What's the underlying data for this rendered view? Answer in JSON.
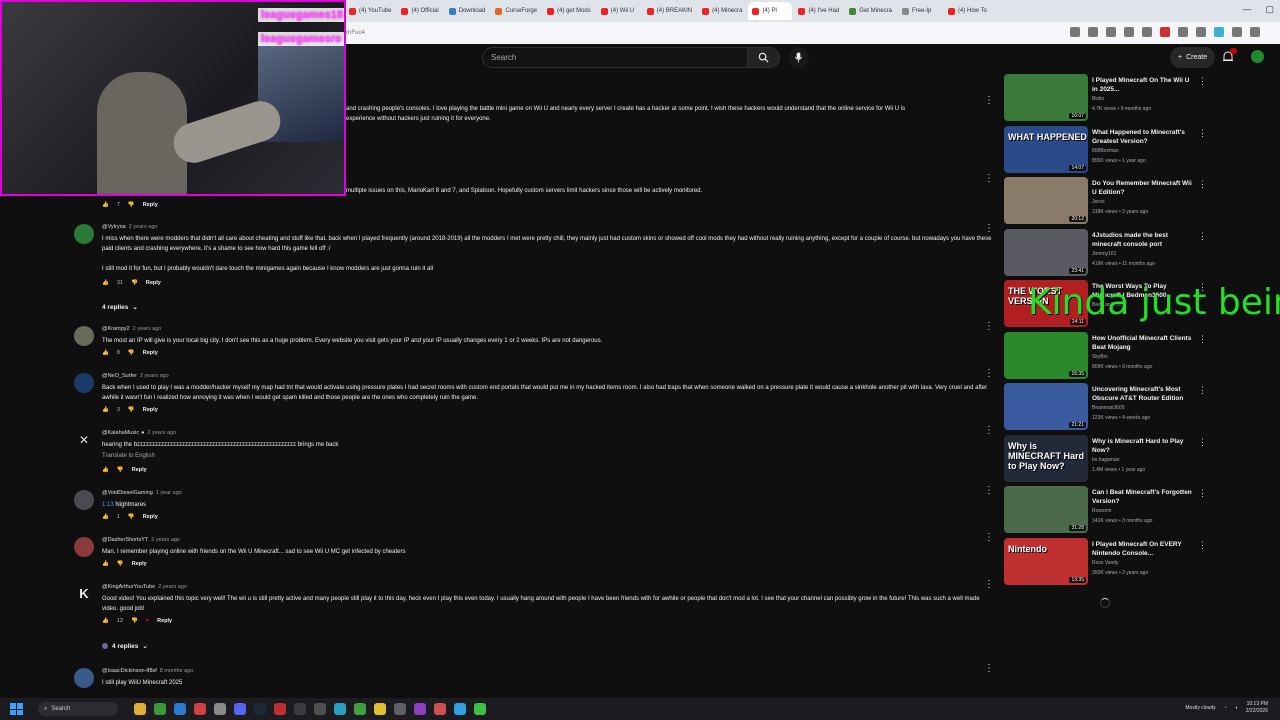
{
  "browser": {
    "tabs": [
      "(4) YouTube",
      "(4) Official",
      "Download",
      "CurseForge",
      "(4) get Mods",
      "(4) Wii U",
      "(4) BREAKIN",
      "(4) Minecra",
      "(4) Pl",
      "(4) I've Had",
      "Get Minecra",
      "Free-Ip",
      "(4) How To"
    ],
    "url": "xnFuo4"
  },
  "yt": {
    "search_placeholder": "Search",
    "create_label": "Create"
  },
  "webcam": {
    "ticker_line1": "leaguegames18",
    "ticker_line2": "leaguegamesre"
  },
  "comments": [
    {
      "text": "and crashing people's consoles. I love playing the battle mini game on Wii U and nearly every server I create has a hacker at some point. I wish these hackers would understand that the online service for Wii U is",
      "text2": "experience without hackers just ruining it for everyone."
    },
    {
      "text": "multiple issues on this, MarioKart 8 and 7, and Splatoon. Hopefully custom servers limit hackers since those will be actively monitored.",
      "likes": "7",
      "reply": "Reply"
    },
    {
      "author": "@Vylryna",
      "ago": "2 years ago",
      "text": "I miss when there were modders that didn't all care about cheating and stuff like that. back when I played frequently (around 2018-2019) all the modders I met were pretty chill, they mainly just had custom skins or showed off cool mods they had without really ruining anything, except for a couple of course. but nowadays you have these paid clients and crashing everywhere, it's a shame to see how hard this game fell off :/",
      "text2": "I still mod it for fun, but I probably wouldn't dare touch the minigames again because I know modders are just gonna ruin it all",
      "likes": "31",
      "reply": "Reply",
      "replies": "4 replies"
    },
    {
      "author": "@Krampy2",
      "ago": "2 years ago",
      "text": "The most an IP will give is your local big city. I don't see this as a huge problem. Every website you visit gets your IP and your IP usually changes every 1 or 2 weeks. IPs are not dangerous.",
      "likes": "8",
      "reply": "Reply"
    },
    {
      "author": "@NeO_Surfer",
      "ago": "2 years ago",
      "text": "Back when I used to play I was a modder/hacker myself my map had tnt that would activate using pressure plates I had secret rooms with custom end portals that would put me in my hacked items room. I also had traps that when someone walked on a pressure plate it would cause a sinkhole another pit with lava. Very cruel and after awhile it wasn't fun I realized how annoying it was when I would get spam killed and those people are the ones who completely ruin the game.",
      "likes": "3",
      "reply": "Reply"
    },
    {
      "author": "@KalahaMusic",
      "ago": "2 years ago",
      "text": "hearing the bzzzzzzzzzzzzzzzzzzzzzzzzzzzzzzzzzzzzzzzzzzzzzzzzzzzzz brings me back",
      "translate": "Translate to English",
      "reply": "Reply"
    },
    {
      "author": "@VoidDieselGaming",
      "ago": "1 year ago",
      "timestamp": "1:13",
      "text": " Nightmares",
      "likes": "1",
      "reply": "Reply"
    },
    {
      "author": "@DasherShortsYT",
      "ago": "2 years ago",
      "text": "Man, I remember playing online with friends on the Wii U Minecraft... sad to see Wii U MC get infected by cheaters",
      "reply": "Reply"
    },
    {
      "author": "@KingArthurYouTube",
      "ago": "2 years ago",
      "text": "Good video! You explained this topic very well! The wii u is still pretty active and many people still play it to this day, heck even I play this even today. I usually hang around with people I have been friends with for awhile or people that don't mod a lot. I see that your channel can possibly grow in the future! This was such a well made video. good job!",
      "likes": "12",
      "reply": "Reply",
      "replies": "4 replies"
    },
    {
      "author": "@IsaacDickinson-tf8sf",
      "ago": "8 months ago",
      "text": "I still play WiiU Minecraft 2025"
    }
  ],
  "sidebar": [
    {
      "title": "I Played Minecraft On The Wii U in 2025...",
      "channel": "Bixito",
      "meta": "4.7K views • 9 months ago",
      "duration": "16:07",
      "color": "#3a7a3a"
    },
    {
      "title": "What Happened to Minecraft's Greatest Version?",
      "channel": "808Boxman",
      "meta": "855K views • 1 year ago",
      "duration": "14:07",
      "thumb_text": "WHAT HAPPENED",
      "color": "#2a4a8a"
    },
    {
      "title": "Do You Remember Minecraft Wii U Edition?",
      "channel": "Jeroo",
      "meta": "318K views • 2 years ago",
      "duration": "20:12",
      "color": "#8a7a6a"
    },
    {
      "title": "4Jstudios made the best minecraft console port",
      "channel": "Jommy161",
      "meta": "419K views • 11 months ago",
      "duration": "23:41",
      "color": "#5a5a62"
    },
    {
      "title": "The Worst Ways To Play Minecraft | Bedman3600",
      "channel": "Bedman3600",
      "meta": "",
      "duration": "24:11",
      "thumb_text": "THE WORST VERSION",
      "color": "#b02020"
    },
    {
      "title": "How Unofficial Minecraft Clients Beat Mojang",
      "channel": "SkyBoi",
      "meta": "809K views • 9 months ago",
      "duration": "16:35",
      "color": "#2a8a2a"
    },
    {
      "title": "Uncovering Minecraft's Most Obscure AT&T Router Edition",
      "channel": "Beanman3600",
      "meta": "123K views • 4 weeks ago",
      "duration": "21:21",
      "color": "#3a5aa0"
    },
    {
      "title": "Why is Minecraft Hard to Play Now?",
      "channel": "bs.hagaman",
      "meta": "1.4M views • 1 year ago",
      "duration": "",
      "thumb_text": "Why is MINECRAFT Hard to Play Now?",
      "color": "#222a3a"
    },
    {
      "title": "Can I Beat Minecraft's Forgotten Version?",
      "channel": "Rowsmn",
      "meta": "141K views • 3 months ago",
      "duration": "31:28",
      "color": "#4a6a4a"
    },
    {
      "title": "I Played Minecraft On EVERY Nintendo Console...",
      "channel": "Ross Vandy",
      "meta": "350K views • 2 years ago",
      "duration": "13:35",
      "thumb_text": "Nintendo",
      "color": "#c03030"
    }
  ],
  "overlay": {
    "text": "Kinda just being"
  },
  "taskbar": {
    "search_label": "Search",
    "weather": "Mostly cloudy",
    "time": "10:13 PM",
    "date": "2/22/2026"
  },
  "colors": {
    "accent_magenta": "#e000e0",
    "overlay_green": "#22e022",
    "yt_bg": "#0f0f0f"
  }
}
